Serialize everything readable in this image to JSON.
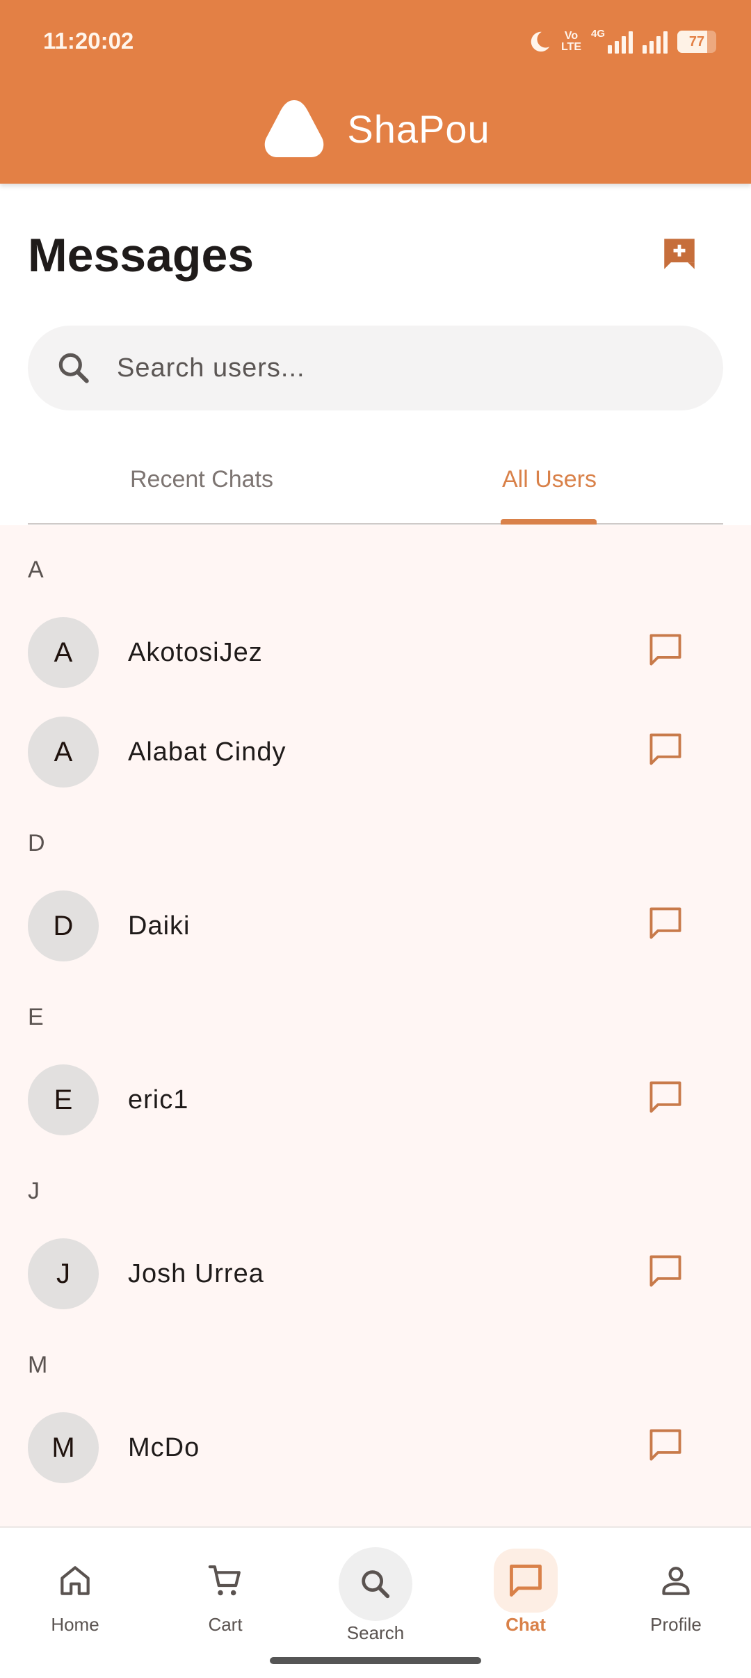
{
  "status_bar": {
    "time": "11:20:02",
    "volte_line1": "Vo",
    "volte_line2": "LTE",
    "network": "4G",
    "battery": "77",
    "battery_level_percent": 77
  },
  "header": {
    "app_name": "ShaPou",
    "logo_icon": "cloud-logo-icon"
  },
  "page": {
    "title": "Messages",
    "new_chat_icon": "add-message-icon"
  },
  "search": {
    "placeholder": "Search users...",
    "value": ""
  },
  "tabs": [
    {
      "label": "Recent Chats",
      "active": false
    },
    {
      "label": "All Users",
      "active": true
    }
  ],
  "sections": [
    {
      "letter": "A",
      "users": [
        {
          "initial": "A",
          "name": "AkotosiJez"
        },
        {
          "initial": "A",
          "name": "Alabat Cindy"
        }
      ]
    },
    {
      "letter": "D",
      "users": [
        {
          "initial": "D",
          "name": "Daiki"
        }
      ]
    },
    {
      "letter": "E",
      "users": [
        {
          "initial": "E",
          "name": "eric1"
        }
      ]
    },
    {
      "letter": "J",
      "users": [
        {
          "initial": "J",
          "name": "Josh Urrea"
        }
      ]
    },
    {
      "letter": "M",
      "users": [
        {
          "initial": "M",
          "name": "McDo"
        }
      ]
    }
  ],
  "bottom_nav": [
    {
      "label": "Home",
      "icon": "home-icon",
      "active": false
    },
    {
      "label": "Cart",
      "icon": "cart-icon",
      "active": false
    },
    {
      "label": "Search",
      "icon": "search-icon",
      "active": false
    },
    {
      "label": "Chat",
      "icon": "chat-icon",
      "active": true
    },
    {
      "label": "Profile",
      "icon": "profile-icon",
      "active": false
    }
  ],
  "colors": {
    "brand": "#e38045",
    "accent": "#d98149",
    "list_background": "#fff6f4",
    "avatar_background": "#e2e0df"
  }
}
